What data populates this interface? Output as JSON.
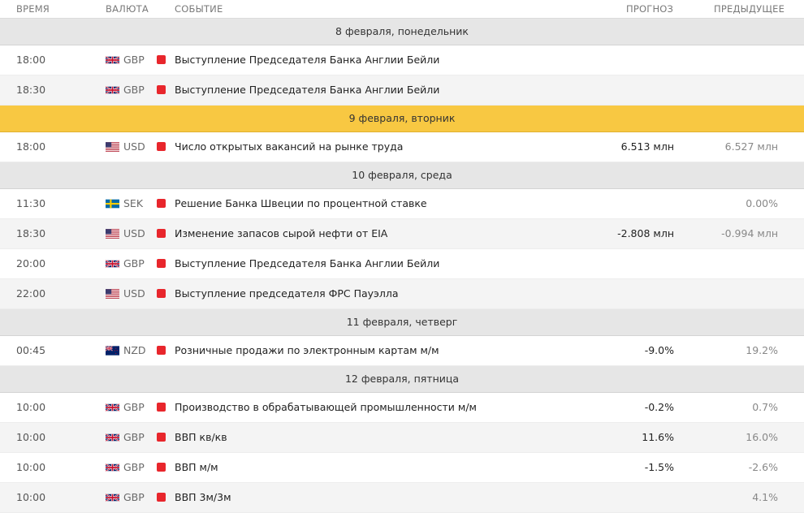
{
  "header": {
    "time": "ВРЕМЯ",
    "currency": "ВАЛЮТА",
    "event": "СОБЫТИЕ",
    "forecast": "ПРОГНОЗ",
    "previous": "ПРЕДЫДУЩЕЕ"
  },
  "rows": [
    {
      "type": "day",
      "label": "8 февраля, понедельник"
    },
    {
      "type": "event",
      "time": "18:00",
      "flag": "uk-flag-icon",
      "currency": "GBP",
      "event": "Выступление Председателя Банка Англии Бейли",
      "forecast": "",
      "previous": ""
    },
    {
      "type": "event",
      "time": "18:30",
      "flag": "uk-flag-icon",
      "currency": "GBP",
      "event": "Выступление Председателя Банка Англии Бейли",
      "forecast": "",
      "previous": ""
    },
    {
      "type": "day",
      "label": "9 февраля, вторник",
      "highlight": true
    },
    {
      "type": "event",
      "time": "18:00",
      "flag": "us-flag-icon",
      "currency": "USD",
      "event": "Число открытых вакансий на рынке труда",
      "forecast": "6.513 млн",
      "previous": "6.527 млн"
    },
    {
      "type": "day",
      "label": "10 февраля, среда"
    },
    {
      "type": "event",
      "time": "11:30",
      "flag": "se-flag-icon",
      "currency": "SEK",
      "event": "Решение Банка Швеции по процентной ставке",
      "forecast": "",
      "previous": "0.00%"
    },
    {
      "type": "event",
      "time": "18:30",
      "flag": "us-flag-icon",
      "currency": "USD",
      "event": "Изменение запасов сырой нефти от EIA",
      "forecast": "-2.808 млн",
      "previous": "-0.994 млн"
    },
    {
      "type": "event",
      "time": "20:00",
      "flag": "uk-flag-icon",
      "currency": "GBP",
      "event": "Выступление Председателя Банка Англии Бейли",
      "forecast": "",
      "previous": ""
    },
    {
      "type": "event",
      "time": "22:00",
      "flag": "us-flag-icon",
      "currency": "USD",
      "event": "Выступление председателя ФРС Пауэлла",
      "forecast": "",
      "previous": ""
    },
    {
      "type": "day",
      "label": "11 февраля, четверг"
    },
    {
      "type": "event",
      "time": "00:45",
      "flag": "nz-flag-icon",
      "currency": "NZD",
      "event": "Розничные продажи по электронным картам м/м",
      "forecast": "-9.0%",
      "previous": "19.2%"
    },
    {
      "type": "day",
      "label": "12 февраля, пятница"
    },
    {
      "type": "event",
      "time": "10:00",
      "flag": "uk-flag-icon",
      "currency": "GBP",
      "event": "Производство в обрабатывающей промышленности м/м",
      "forecast": "-0.2%",
      "previous": "0.7%"
    },
    {
      "type": "event",
      "time": "10:00",
      "flag": "uk-flag-icon",
      "currency": "GBP",
      "event": "ВВП кв/кв",
      "forecast": "11.6%",
      "previous": "16.0%"
    },
    {
      "type": "event",
      "time": "10:00",
      "flag": "uk-flag-icon",
      "currency": "GBP",
      "event": "ВВП м/м",
      "forecast": "-1.5%",
      "previous": "-2.6%"
    },
    {
      "type": "event",
      "time": "10:00",
      "flag": "uk-flag-icon",
      "currency": "GBP",
      "event": "ВВП 3м/3м",
      "forecast": "",
      "previous": "4.1%"
    }
  ],
  "colors": {
    "importance_high": "#e8262c",
    "today_band": "#f8c842",
    "day_band": "#e6e6e6",
    "alt_row": "#f4f4f4"
  }
}
